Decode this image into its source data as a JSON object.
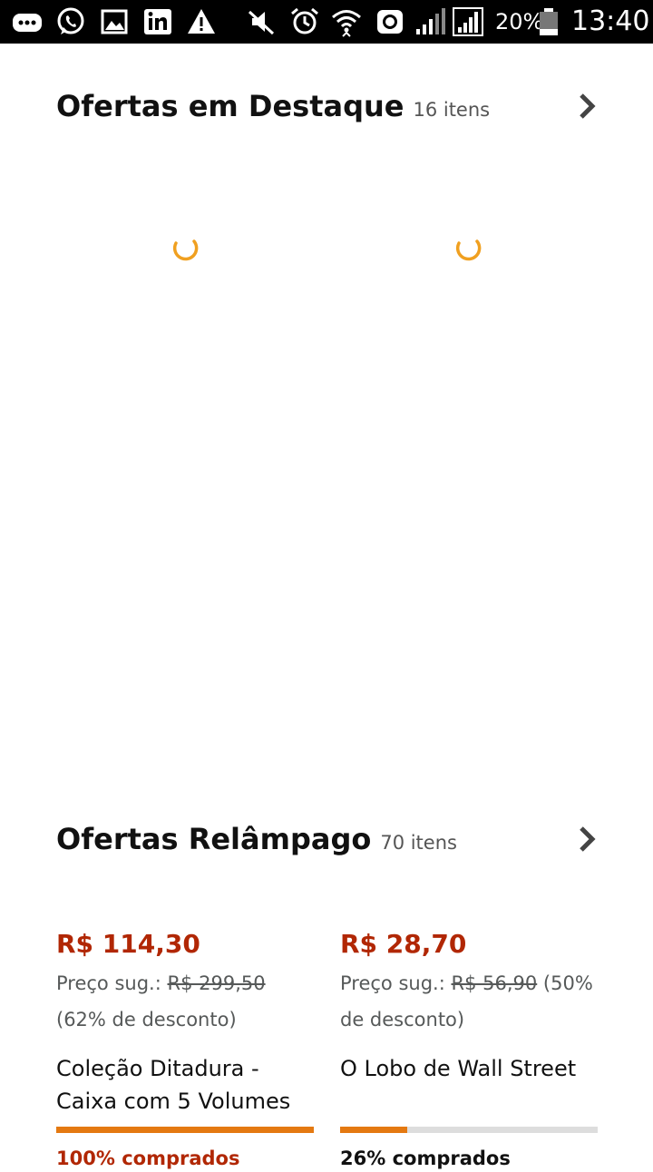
{
  "status_bar": {
    "battery_percent": "20%",
    "time": "13:40"
  },
  "featured": {
    "title": "Ofertas em Destaque",
    "count": "16 itens"
  },
  "lightning": {
    "title": "Ofertas Relâmpago",
    "count": "70 itens",
    "deals": [
      {
        "price": "R$ 114,30",
        "list_label": "Preço sug.:",
        "list_price": "R$ 299,50",
        "discount": "(62% de desconto)",
        "title": "Coleção Ditadura - Caixa com 5 Volumes",
        "claimed_fraction": 1.0,
        "claimed_text": "100% comprados"
      },
      {
        "price": "R$ 28,70",
        "list_label": "Preço sug.:",
        "list_price": "R$ 56,90",
        "discount": "(50% de desconto)",
        "title": "O Lobo de Wall Street",
        "claimed_fraction": 0.26,
        "claimed_text": "26% comprados"
      }
    ]
  },
  "colors": {
    "price": "#b12704",
    "progress": "#e47911",
    "progress_track": "#dddddd",
    "spinner": "#f0a020"
  }
}
